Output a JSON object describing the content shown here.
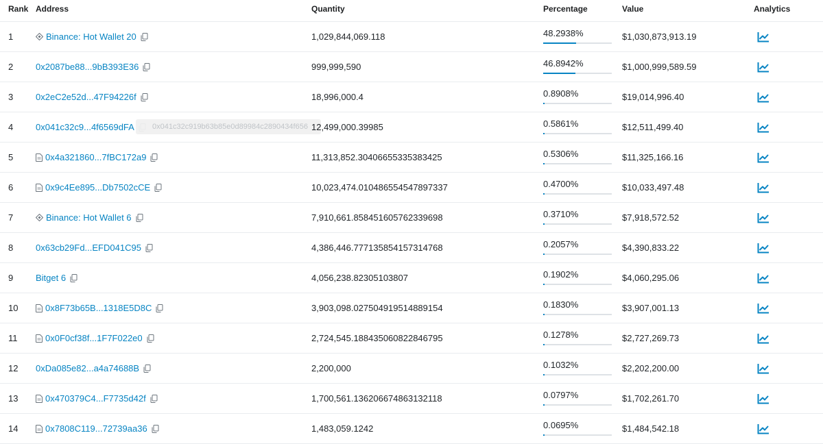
{
  "headers": {
    "rank": "Rank",
    "address": "Address",
    "quantity": "Quantity",
    "percentage": "Percentage",
    "value": "Value",
    "analytics": "Analytics"
  },
  "colors": {
    "link": "#0784c3",
    "bar_track": "#dee2e6",
    "bar_fill": "#0784c3"
  },
  "tooltip": {
    "text": "0x041c32c919b63b85e0d89984c2890434f656"
  },
  "rows": [
    {
      "rank": "1",
      "address": "Binance: Hot Wallet 20",
      "addr_icon": "diamond-icon",
      "quantity": "1,029,844,069.118",
      "percentage": "48.2938%",
      "pct_value": 48.2938,
      "value": "$1,030,873,913.19"
    },
    {
      "rank": "2",
      "address": "0x2087be88...9bB393E36",
      "addr_icon": "",
      "quantity": "999,999,590",
      "percentage": "46.8942%",
      "pct_value": 46.8942,
      "value": "$1,000,999,589.59"
    },
    {
      "rank": "3",
      "address": "0x2eC2e52d...47F94226f",
      "addr_icon": "",
      "quantity": "18,996,000.4",
      "percentage": "0.8908%",
      "pct_value": 0.8908,
      "value": "$19,014,996.40"
    },
    {
      "rank": "4",
      "address": "0x041c32c9...4f6569dFA",
      "addr_icon": "",
      "quantity": "12,499,000.39985",
      "percentage": "0.5861%",
      "pct_value": 0.5861,
      "value": "$12,511,499.40"
    },
    {
      "rank": "5",
      "address": "0x4a321860...7fBC172a9",
      "addr_icon": "contract-icon",
      "quantity": "11,313,852.30406655335383425",
      "percentage": "0.5306%",
      "pct_value": 0.5306,
      "value": "$11,325,166.16"
    },
    {
      "rank": "6",
      "address": "0x9c4Ee895...Db7502cCE",
      "addr_icon": "contract-icon",
      "quantity": "10,023,474.010486554547897337",
      "percentage": "0.4700%",
      "pct_value": 0.47,
      "value": "$10,033,497.48"
    },
    {
      "rank": "7",
      "address": "Binance: Hot Wallet 6",
      "addr_icon": "diamond-icon",
      "quantity": "7,910,661.858451605762339698",
      "percentage": "0.3710%",
      "pct_value": 0.371,
      "value": "$7,918,572.52"
    },
    {
      "rank": "8",
      "address": "0x63cb29Fd...EFD041C95",
      "addr_icon": "",
      "quantity": "4,386,446.777135854157314768",
      "percentage": "0.2057%",
      "pct_value": 0.2057,
      "value": "$4,390,833.22"
    },
    {
      "rank": "9",
      "address": "Bitget 6",
      "addr_icon": "",
      "quantity": "4,056,238.82305103807",
      "percentage": "0.1902%",
      "pct_value": 0.1902,
      "value": "$4,060,295.06"
    },
    {
      "rank": "10",
      "address": "0x8F73b65B...1318E5D8C",
      "addr_icon": "contract-icon",
      "quantity": "3,903,098.027504919514889154",
      "percentage": "0.1830%",
      "pct_value": 0.183,
      "value": "$3,907,001.13"
    },
    {
      "rank": "11",
      "address": "0x0F0cf38f...1F7F022e0",
      "addr_icon": "contract-icon",
      "quantity": "2,724,545.188435060822846795",
      "percentage": "0.1278%",
      "pct_value": 0.1278,
      "value": "$2,727,269.73"
    },
    {
      "rank": "12",
      "address": "0xDa085e82...a4a74688B",
      "addr_icon": "",
      "quantity": "2,200,000",
      "percentage": "0.1032%",
      "pct_value": 0.1032,
      "value": "$2,202,200.00"
    },
    {
      "rank": "13",
      "address": "0x470379C4...F7735d42f",
      "addr_icon": "contract-icon",
      "quantity": "1,700,561.136206674863132118",
      "percentage": "0.0797%",
      "pct_value": 0.0797,
      "value": "$1,702,261.70"
    },
    {
      "rank": "14",
      "address": "0x7808C119...72739aa36",
      "addr_icon": "contract-icon",
      "quantity": "1,483,059.1242",
      "percentage": "0.0695%",
      "pct_value": 0.0695,
      "value": "$1,484,542.18"
    }
  ]
}
